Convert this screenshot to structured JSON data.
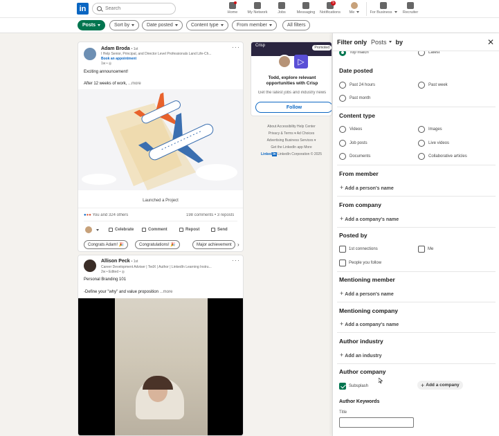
{
  "nav": {
    "logo": "in",
    "search_placeholder": "Search",
    "items": [
      {
        "label": "Home",
        "badge": ""
      },
      {
        "label": "My Network",
        "badge": ""
      },
      {
        "label": "Jobs",
        "badge": ""
      },
      {
        "label": "Messaging",
        "badge": ""
      },
      {
        "label": "Notifications",
        "badge": "5"
      },
      {
        "label": "Me",
        "badge": ""
      },
      {
        "label": "For Business",
        "badge": ""
      },
      {
        "label": "Recruiter",
        "badge": ""
      }
    ]
  },
  "filters": {
    "posts": "Posts",
    "sort_by": "Sort by",
    "date_posted": "Date posted",
    "content_type": "Content type",
    "from_member": "From member",
    "all_filters": "All filters"
  },
  "post1": {
    "author": "Adam Broda",
    "degree": "• 1st",
    "headline": "I Help Senior, Principal, and Director Level Professionals Land Life-Ch...",
    "cta": "Book an appointment",
    "time": "1w •",
    "text_line1": "Exciting announcement!",
    "text_line2": "After 12 weeks of work,",
    "more": "...more",
    "caption": "Launched a Project",
    "reactions": "You and 324 others",
    "stats": "198 comments • 3 reposts",
    "actions": [
      "Celebrate",
      "Comment",
      "Repost",
      "Send"
    ],
    "chips": [
      "Congrats Adam! 🎉",
      "Congratulations! 🎉",
      "Major achievement"
    ]
  },
  "post2": {
    "author": "Allison Peck",
    "degree": "• 1st",
    "headline": "Career Development Adviser | TedX | Author | LinkedIn Learning Instru...",
    "time": "2w • Edited •",
    "text_line1": "Personal Branding 101",
    "text_line2": "-Define your \"why\" and value proposition",
    "more": "...more"
  },
  "ad": {
    "brand": "Crisp",
    "promoted": "Promoted",
    "title": "Todd, explore relevant opportunities with Crisp",
    "subtitle": "Get the latest jobs and industry news",
    "button": "Follow"
  },
  "footer": {
    "row1": "About   Accessibility   Help Center",
    "row2": "Privacy & Terms ▾   Ad Choices",
    "row3": "Advertising   Business Services ▾",
    "row4": "Get the LinkedIn app   More",
    "copyright": "LinkedIn Corporation © 2025"
  },
  "panel": {
    "filter_only": "Filter only",
    "posts": "Posts",
    "by": "by",
    "top_opt_left": "Top match",
    "top_opt_right": "Latest",
    "date_posted": {
      "title": "Date posted",
      "options": [
        "Past 24 hours",
        "Past week",
        "Past month"
      ]
    },
    "content_type": {
      "title": "Content type",
      "options": [
        "Videos",
        "Images",
        "Job posts",
        "Live videos",
        "Documents",
        "Collaborative articles"
      ]
    },
    "from_member": {
      "title": "From member",
      "add": "Add a person's name"
    },
    "from_company": {
      "title": "From company",
      "add": "Add a company's name"
    },
    "posted_by": {
      "title": "Posted by",
      "options": [
        "1st connections",
        "Me",
        "People you follow"
      ]
    },
    "mentioning_member": {
      "title": "Mentioning member",
      "add": "Add a person's name"
    },
    "mentioning_company": {
      "title": "Mentioning company",
      "add": "Add a company's name"
    },
    "author_industry": {
      "title": "Author industry",
      "add": "Add an industry"
    },
    "author_company": {
      "title": "Author company",
      "checked": "Subsplash",
      "add": "Add a company"
    },
    "author_keywords": {
      "title": "Author Keywords",
      "field_label": "Title",
      "field_value": ""
    }
  }
}
